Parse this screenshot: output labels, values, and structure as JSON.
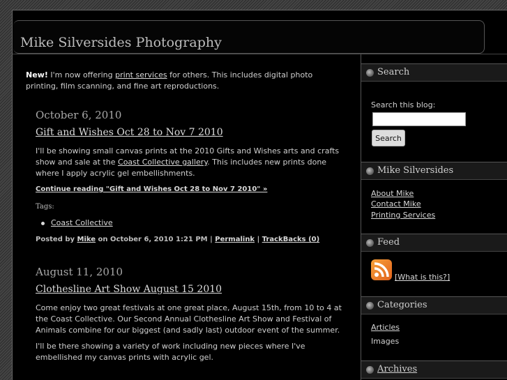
{
  "site": {
    "title": "Mike Silversides Photography"
  },
  "intro": {
    "new_label": "New!",
    "text_before": " I'm now offering ",
    "link": "print services",
    "text_after": " for others. This includes digital photo printing, film scanning, and fine art reproductions."
  },
  "posts": [
    {
      "date": "October 6, 2010",
      "title": "Gift and Wishes Oct 28 to Nov 7 2010",
      "para1_before": "I'll be showing small canvas prints at the 2010 Gifts and Wishes arts and crafts show and sale at the ",
      "para1_link": "Coast Collective gallery",
      "para1_after": ". This includes new prints done where I apply acrylic gel embellishments.",
      "read_more": "Continue reading \"Gift and Wishes Oct 28 to Nov 7 2010\" »",
      "tags_label": "Tags:",
      "tags": [
        "Coast Collective"
      ],
      "posted_by_label": "Posted by ",
      "author": "Mike",
      "posted_on": " on October 6, 2010 1:21 PM | ",
      "permalink": "Permalink",
      "separator": " | ",
      "trackbacks": "TrackBacks (0)"
    },
    {
      "date": "August 11, 2010",
      "title": "Clothesline Art Show August 15 2010",
      "para1": "Come enjoy two great festivals at one great place, August 15th, from 10 to 4 at the Coast Collective. Our Second Annual Clothesline Art Show and Festival of Animals combine for our biggest (and sadly last) outdoor event of the summer.",
      "para2": "I'll be there showing a variety of work including new pieces where I've embellished my canvas prints with acrylic gel."
    }
  ],
  "sidebar": {
    "search": {
      "heading": "Search",
      "label": "Search this blog:",
      "placeholder": "",
      "button": "Search"
    },
    "about": {
      "heading": "Mike Silversides",
      "links": [
        "About Mike",
        "Contact Mike",
        "Printing Services"
      ]
    },
    "feed": {
      "heading": "Feed",
      "link": "[What is this?]",
      "icon": "rss-icon",
      "color": "#f28a2e"
    },
    "categories": {
      "heading": "Categories",
      "items": [
        "Articles",
        "Images"
      ]
    },
    "archives": {
      "heading": "Archives"
    }
  }
}
